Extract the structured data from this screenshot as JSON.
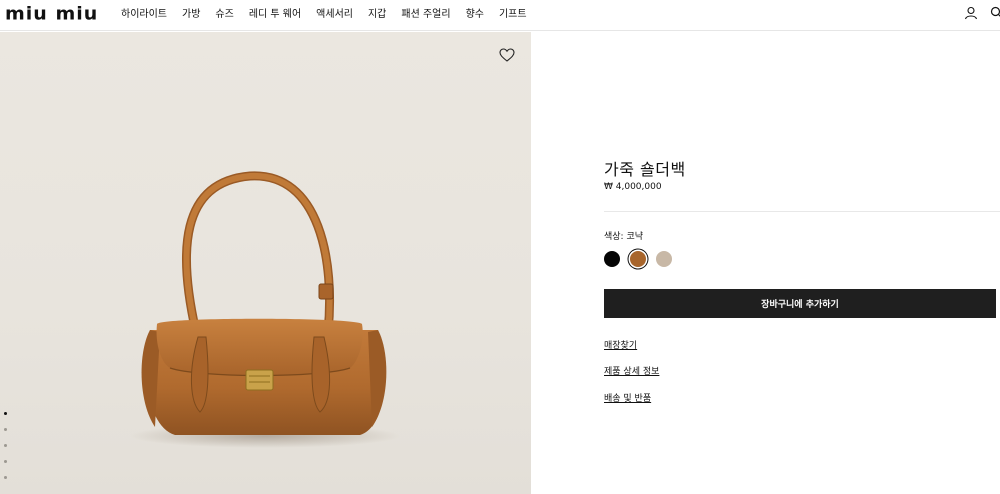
{
  "header": {
    "logo": "miu miu",
    "nav": [
      "하이라이트",
      "가방",
      "슈즈",
      "레디 투 웨어",
      "액세서리",
      "지갑",
      "패션 주얼리",
      "향수",
      "기프트"
    ]
  },
  "gallery": {
    "image_count": 5,
    "active_index": 0
  },
  "product": {
    "title": "가죽 숄더백",
    "price": "₩ 4,000,000",
    "color_label": "색상: 코냑",
    "swatches": [
      {
        "name": "black",
        "color": "#050505"
      },
      {
        "name": "cognac",
        "color": "#a8652b"
      },
      {
        "name": "beige",
        "color": "#c8b8a6"
      }
    ],
    "selected_swatch": 1,
    "cart_button": "장바구니에 추가하기",
    "links": {
      "store": "매장찾기",
      "details": "제품 상세 정보",
      "shipping": "배송 및 반품"
    }
  },
  "colors": {
    "button_bg": "#1f1f1f",
    "leather": "#b06a2e"
  }
}
